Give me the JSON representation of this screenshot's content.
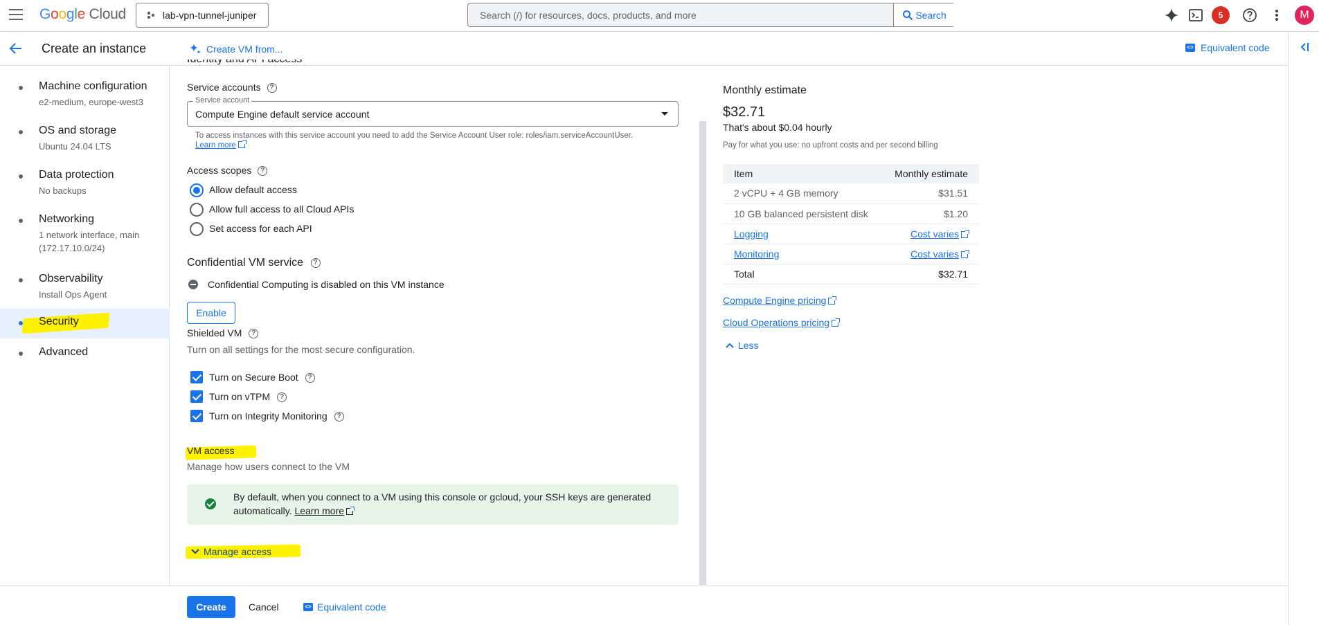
{
  "topbar": {
    "product": "Cloud",
    "project": "lab-vpn-tunnel-juniper",
    "search_placeholder": "Search (/) for resources, docs, products, and more",
    "search_button": "Search",
    "notification_count": "5",
    "avatar_initial": "M"
  },
  "header": {
    "title": "Create an instance",
    "create_from": "Create VM from...",
    "equivalent_code": "Equivalent code"
  },
  "sidebar": {
    "items": [
      {
        "label": "Machine configuration",
        "sub": "e2-medium, europe-west3"
      },
      {
        "label": "OS and storage",
        "sub": "Ubuntu 24.04 LTS"
      },
      {
        "label": "Data protection",
        "sub": "No backups"
      },
      {
        "label": "Networking",
        "sub": "1 network interface, main",
        "sub2": "(172.17.10.0/24)"
      },
      {
        "label": "Observability",
        "sub": "Install Ops Agent"
      },
      {
        "label": "Security"
      },
      {
        "label": "Advanced"
      }
    ]
  },
  "main": {
    "section_cutoff": "Identity and API access",
    "service_accounts_title": "Service accounts",
    "service_account_legend": "Service account",
    "service_account_value": "Compute Engine default service account",
    "service_account_hint": "To access instances with this service account you need to add the Service Account User role: roles/iam.serviceAccountUser.",
    "learn_more": "Learn more",
    "access_scopes_title": "Access scopes",
    "scopes": [
      "Allow default access",
      "Allow full access to all Cloud APIs",
      "Set access for each API"
    ],
    "confidential_title": "Confidential VM service",
    "confidential_status": "Confidential Computing is disabled on this VM instance",
    "enable_button": "Enable",
    "shielded_title": "Shielded VM",
    "shielded_desc": "Turn on all settings for the most secure configuration.",
    "shielded_options": [
      "Turn on Secure Boot",
      "Turn on vTPM",
      "Turn on Integrity Monitoring"
    ],
    "vm_access_title": "VM access",
    "vm_access_desc": "Manage how users connect to the VM",
    "ssh_info_line1": "By default, when you connect to a VM using this console or gcloud, your SSH keys are generated",
    "ssh_info_line2": "automatically.",
    "ssh_learn_more": "Learn more",
    "manage_access": "Manage access"
  },
  "estimate": {
    "title": "Monthly estimate",
    "price": "$32.71",
    "hourly": "That's about $0.04 hourly",
    "note": "Pay for what you use: no upfront costs and per second billing",
    "col_item": "Item",
    "col_estimate": "Monthly estimate",
    "rows": [
      {
        "item": "2 vCPU + 4 GB memory",
        "value": "$31.51"
      },
      {
        "item": "10 GB balanced persistent disk",
        "value": "$1.20"
      },
      {
        "item": "Logging",
        "value": "Cost varies"
      },
      {
        "item": "Monitoring",
        "value": "Cost varies"
      },
      {
        "item": "Total",
        "value": "$32.71"
      }
    ],
    "link_compute": "Compute Engine pricing",
    "link_ops": "Cloud Operations pricing",
    "less": "Less"
  },
  "footer": {
    "create": "Create",
    "cancel": "Cancel",
    "equivalent_code": "Equivalent code"
  },
  "colors": {
    "accent": "#1a73e8",
    "highlight": "#fff200",
    "success": "#188038"
  }
}
